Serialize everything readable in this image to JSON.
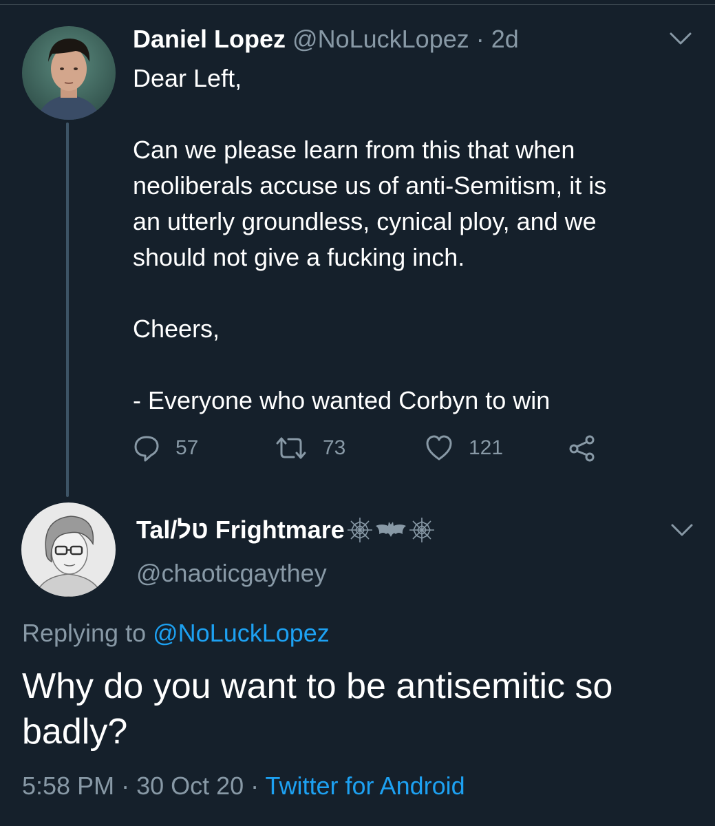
{
  "original_tweet": {
    "author_name": "Daniel Lopez",
    "author_handle": "@NoLuckLopez",
    "separator": " · ",
    "time_ago": "2d",
    "text": "Dear Left,\n\nCan we please learn from this that when\nneoliberals accuse us of anti-Semitism, it is\nan utterly groundless, cynical ploy, and we\nshould not give a fucking inch.\n\nCheers,\n\n- Everyone who wanted Corbyn to win",
    "reply_count": "57",
    "retweet_count": "73",
    "like_count": "121",
    "icons": {
      "reply": "comment-bubble-icon",
      "retweet": "retweet-icon",
      "like": "heart-icon",
      "share": "share-icon",
      "menu": "chevron-down-icon"
    }
  },
  "reply_tweet": {
    "author_name": "Tal/טל Frightmare",
    "name_emojis": [
      "spider-web-icon",
      "bat-icon",
      "spider-web-icon"
    ],
    "author_handle": "@chaoticgaythey",
    "replying_prefix": "Replying to ",
    "replying_to": "@NoLuckLopez",
    "text": "Why do you want to be antisemitic so badly?",
    "time": "5:58 PM",
    "date": "30 Oct 20",
    "separator": " · ",
    "source": "Twitter for Android"
  },
  "colors": {
    "background": "#15202b",
    "secondary_text": "#8899a6",
    "link": "#1da1f2",
    "thread_line": "#3d5466"
  }
}
